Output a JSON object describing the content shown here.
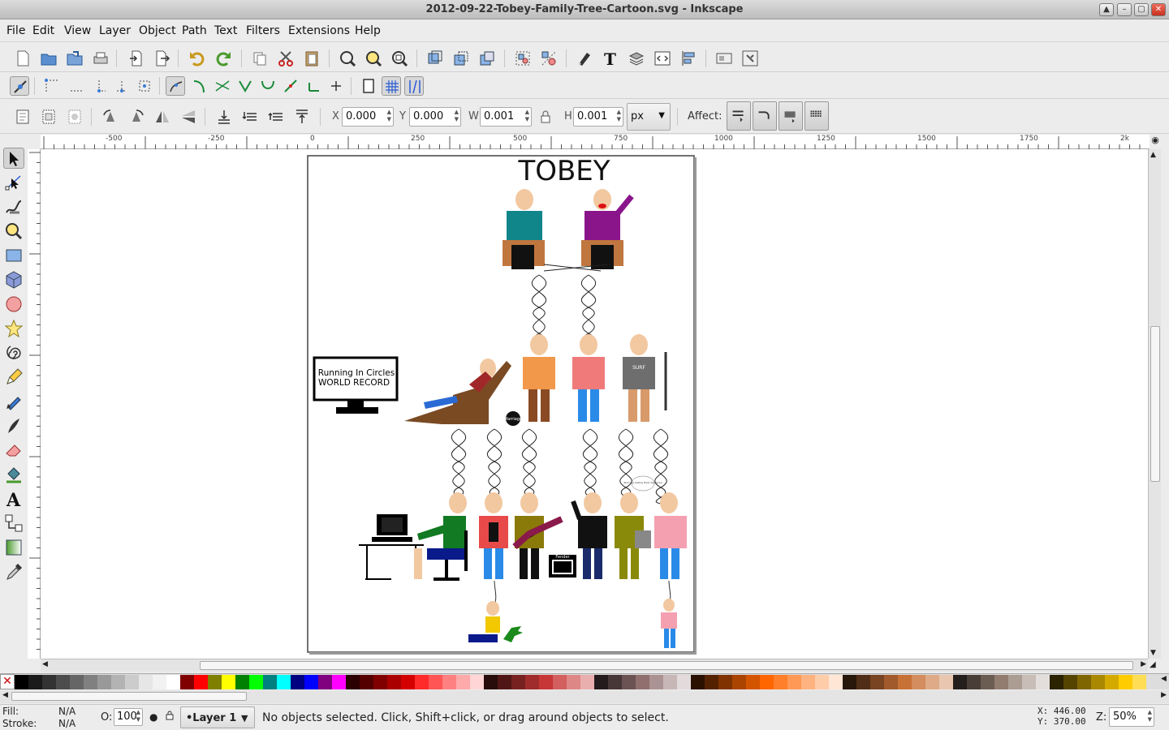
{
  "window": {
    "title": "2012-09-22-Tobey-Family-Tree-Cartoon.svg - Inkscape"
  },
  "menu": [
    "File",
    "Edit",
    "View",
    "Layer",
    "Object",
    "Path",
    "Text",
    "Filters",
    "Extensions",
    "Help"
  ],
  "toolbar": {
    "x_label": "X",
    "x_value": "0.000",
    "y_label": "Y",
    "y_value": "0.000",
    "w_label": "W",
    "w_value": "0.001",
    "h_label": "H",
    "h_value": "0.001",
    "unit": "px",
    "affect_label": "Affect:"
  },
  "ruler": {
    "top_ticks": [
      "-500",
      "-250",
      "0",
      "250",
      "500",
      "750",
      "1000",
      "1250",
      "1500",
      "1750",
      "2k"
    ]
  },
  "drawing": {
    "title": "TOBEY",
    "tv_line1": "Running In Circles",
    "tv_line2": "WORLD RECORD",
    "shirt_text": "SURF",
    "ball_text": "Marriage",
    "amp_text": "Fender",
    "speech_text": "Running Calling Hello Someone"
  },
  "palette": [
    "#000000",
    "#1a1a1a",
    "#333333",
    "#4d4d4d",
    "#666666",
    "#808080",
    "#999999",
    "#b3b3b3",
    "#cccccc",
    "#e6e6e6",
    "#f2f2f2",
    "#ffffff",
    "#800000",
    "#ff0000",
    "#808000",
    "#ffff00",
    "#008000",
    "#00ff00",
    "#008080",
    "#00ffff",
    "#000080",
    "#0000ff",
    "#800080",
    "#ff00ff",
    "#2b0000",
    "#550000",
    "#800000",
    "#aa0000",
    "#d40000",
    "#ff2a2a",
    "#ff5555",
    "#ff8080",
    "#ffaaaa",
    "#ffd5d5",
    "#280b0b",
    "#501616",
    "#782121",
    "#a02c2c",
    "#c83737",
    "#d35f5f",
    "#de8787",
    "#e9afaf",
    "#241c1c",
    "#483737",
    "#6c5353",
    "#916f6f",
    "#ac9393",
    "#c8b7b7",
    "#e3dbdb",
    "#2b1100",
    "#552200",
    "#803300",
    "#aa4400",
    "#d45500",
    "#ff6600",
    "#ff7f2a",
    "#ff9955",
    "#ffb380",
    "#ffccaa",
    "#ffe6d5",
    "#28170b",
    "#502d16",
    "#784421",
    "#a05a2c",
    "#c87137",
    "#d38d5f",
    "#deaa87",
    "#e9c6af",
    "#241f1c",
    "#483e37",
    "#6c5d53",
    "#917c6f",
    "#ac9d93",
    "#c8beb7",
    "#e3dedb",
    "#2b2200",
    "#554400",
    "#806600",
    "#aa8800",
    "#d4aa00",
    "#ffcc00",
    "#ffdd55",
    "#ffe680"
  ],
  "status": {
    "fill_label": "Fill:",
    "fill_value": "N/A",
    "stroke_label": "Stroke:",
    "stroke_value": "N/A",
    "opacity_label": "O:",
    "opacity_value": "100",
    "layer": "•Layer 1",
    "message": "No objects selected. Click, Shift+click, or drag around objects to select.",
    "x_coord": "X:  446.00",
    "y_coord": "Y:  370.00",
    "zoom_label": "Z:",
    "zoom_value": "50%"
  }
}
